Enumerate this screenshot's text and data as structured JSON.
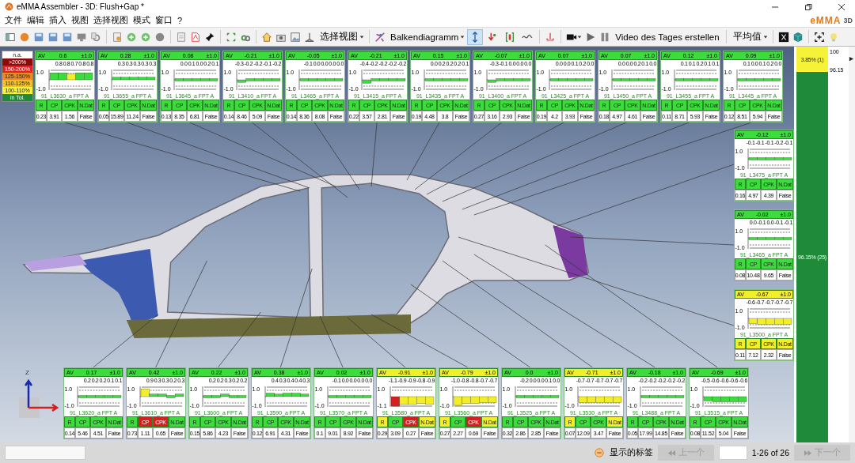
{
  "window": {
    "title": "eMMA Assembler - 3D: Flush+Gap *",
    "logo": {
      "name": "eMMA",
      "suffix": "3D"
    }
  },
  "menu": [
    "文件",
    "编辑",
    "插入",
    "视图",
    "选择视图",
    "模式",
    "窗口",
    "?"
  ],
  "toolbar": {
    "view_menu": "选择视图",
    "chart_menu": "Balkendiagramm",
    "toggles": [
      {
        "selected": true
      },
      {
        "selected": false
      },
      {
        "selected": false
      },
      {
        "selected": false
      }
    ],
    "video_button": "Video des Tages erstellen",
    "stat_menu": "平均值"
  },
  "legend": [
    {
      "label": "n.a.",
      "color": "#ffffff"
    },
    {
      "label": ">200%",
      "color": "#8c0a0a"
    },
    {
      "label": "150-200%",
      "color": "#e02424"
    },
    {
      "label": "125-150%",
      "color": "#ee8a1c"
    },
    {
      "label": "110-125%",
      "color": "#f2c02c"
    },
    {
      "label": "100-110%",
      "color": "#f4f040"
    },
    {
      "label": "in Tol.",
      "color": "#1f8a3a"
    }
  ],
  "gizmo": {
    "z_label": "Z"
  },
  "top_cards": [
    {
      "color": "#3bdc3b",
      "av_label": "AV",
      "av": "0.6",
      "tol": "±1.0",
      "points": [
        {
          "value": "0.8",
          "color": "#3bdc3b"
        },
        {
          "value": "0.8",
          "color": "#3bdc3b"
        },
        {
          "value": "0.7",
          "color": "#f2ee2a"
        },
        {
          "value": "0.8",
          "color": "#3bdc3b"
        },
        {
          "value": "0.8",
          "color": "#3bdc3b"
        }
      ],
      "scale": [
        "1.0",
        "-1.0"
      ],
      "name": "91_L3630_a FPT A",
      "stats": [
        {
          "label": "R",
          "value": "0.23",
          "color": "#3bdc3b"
        },
        {
          "label": "CP",
          "value": "3.91",
          "color": "#3bdc3b"
        },
        {
          "label": "CPK",
          "value": "1.56",
          "color": "#3bdc3b"
        },
        {
          "label": "N.Dat",
          "value": "False",
          "color": "#3bdc3b"
        }
      ]
    },
    {
      "color": "#3bdc3b",
      "av_label": "AV",
      "av": "0.28",
      "tol": "±1.0",
      "points": [
        {
          "value": "0.3",
          "color": "#3bdc3b"
        },
        {
          "value": "0.3",
          "color": "#3bdc3b"
        },
        {
          "value": "0.3",
          "color": "#3bdc3b"
        },
        {
          "value": "0.3",
          "color": "#3bdc3b"
        },
        {
          "value": "0.3",
          "color": "#3bdc3b"
        }
      ],
      "scale": [
        "1.0",
        "-1.0"
      ],
      "name": "91_L3655_a FPT A",
      "stats": [
        {
          "label": "R",
          "value": "0.05",
          "color": "#3bdc3b"
        },
        {
          "label": "CP",
          "value": "15.89",
          "color": "#3bdc3b"
        },
        {
          "label": "CPK",
          "value": "11.24",
          "color": "#3bdc3b"
        },
        {
          "label": "N.Dat",
          "value": "False",
          "color": "#3bdc3b"
        }
      ]
    },
    {
      "color": "#3bdc3b",
      "av_label": "AV",
      "av": "0.08",
      "tol": "±1.0",
      "points": [
        {
          "value": "0.0",
          "color": "#3bdc3b"
        },
        {
          "value": "0.1",
          "color": "#3bdc3b"
        },
        {
          "value": "0.0",
          "color": "#3bdc3b"
        },
        {
          "value": "0.2",
          "color": "#3bdc3b"
        },
        {
          "value": "0.1",
          "color": "#3bdc3b"
        }
      ],
      "scale": [
        "1.0",
        "-1.0"
      ],
      "name": "91_L3645_a FPT A",
      "stats": [
        {
          "label": "R",
          "value": "0.13",
          "color": "#3bdc3b"
        },
        {
          "label": "CP",
          "value": "8.35",
          "color": "#3bdc3b"
        },
        {
          "label": "CPK",
          "value": "6.81",
          "color": "#3bdc3b"
        },
        {
          "label": "N.Dat",
          "value": "False",
          "color": "#3bdc3b"
        }
      ]
    },
    {
      "color": "#3bdc3b",
      "av_label": "AV",
      "av": "-0.21",
      "tol": "±1.0",
      "points": [
        {
          "value": "-0.3",
          "color": "#3bdc3b"
        },
        {
          "value": "-0.2",
          "color": "#3bdc3b"
        },
        {
          "value": "-0.2",
          "color": "#3bdc3b"
        },
        {
          "value": "-0.1",
          "color": "#3bdc3b"
        },
        {
          "value": "-0.2",
          "color": "#3bdc3b"
        }
      ],
      "scale": [
        "1.0",
        "-1.0"
      ],
      "name": "91_L3410_a FPT A",
      "stats": [
        {
          "label": "R",
          "value": "0.14",
          "color": "#3bdc3b"
        },
        {
          "label": "CP",
          "value": "8.46",
          "color": "#3bdc3b"
        },
        {
          "label": "CPK",
          "value": "5.09",
          "color": "#3bdc3b"
        },
        {
          "label": "N.Dat",
          "value": "False",
          "color": "#3bdc3b"
        }
      ]
    },
    {
      "color": "#3bdc3b",
      "av_label": "AV",
      "av": "-0.05",
      "tol": "±1.0",
      "points": [
        {
          "value": "-0.1",
          "color": "#3bdc3b"
        },
        {
          "value": "0.0",
          "color": "#3bdc3b"
        },
        {
          "value": "0.0",
          "color": "#3bdc3b"
        },
        {
          "value": "0.0",
          "color": "#3bdc3b"
        },
        {
          "value": "0.0",
          "color": "#3bdc3b"
        }
      ],
      "scale": [
        "1.0",
        "-1.0"
      ],
      "name": "91_L3465_a FPT A",
      "stats": [
        {
          "label": "R",
          "value": "0.14",
          "color": "#3bdc3b"
        },
        {
          "label": "CP",
          "value": "8.36",
          "color": "#3bdc3b"
        },
        {
          "label": "CPK",
          "value": "8.08",
          "color": "#3bdc3b"
        },
        {
          "label": "N.Dat",
          "value": "False",
          "color": "#3bdc3b"
        }
      ]
    },
    {
      "color": "#3bdc3b",
      "av_label": "AV",
      "av": "-0.21",
      "tol": "±1.0",
      "points": [
        {
          "value": "-0.4",
          "color": "#3bdc3b"
        },
        {
          "value": "-0.2",
          "color": "#3bdc3b"
        },
        {
          "value": "-0.2",
          "color": "#3bdc3b"
        },
        {
          "value": "-0.2",
          "color": "#3bdc3b"
        },
        {
          "value": "-0.2",
          "color": "#3bdc3b"
        }
      ],
      "scale": [
        "1.0",
        "-1.0"
      ],
      "name": "91_L3415_a FPT A",
      "stats": [
        {
          "label": "R",
          "value": "0.22",
          "color": "#3bdc3b"
        },
        {
          "label": "CP",
          "value": "3.57",
          "color": "#3bdc3b"
        },
        {
          "label": "CPK",
          "value": "2.81",
          "color": "#3bdc3b"
        },
        {
          "label": "N.Dat",
          "value": "False",
          "color": "#3bdc3b"
        }
      ]
    },
    {
      "color": "#3bdc3b",
      "av_label": "AV",
      "av": "0.15",
      "tol": "±1.0",
      "points": [
        {
          "value": "0.0",
          "color": "#3bdc3b"
        },
        {
          "value": "0.2",
          "color": "#3bdc3b"
        },
        {
          "value": "0.2",
          "color": "#3bdc3b"
        },
        {
          "value": "0.2",
          "color": "#3bdc3b"
        },
        {
          "value": "0.1",
          "color": "#3bdc3b"
        }
      ],
      "scale": [
        "1.0",
        "-1.0"
      ],
      "name": "91_L3435_a FPT A",
      "stats": [
        {
          "label": "R",
          "value": "0.19",
          "color": "#3bdc3b"
        },
        {
          "label": "CP",
          "value": "4.48",
          "color": "#3bdc3b"
        },
        {
          "label": "CPK",
          "value": "3.8",
          "color": "#3bdc3b"
        },
        {
          "label": "N.Dat",
          "value": "False",
          "color": "#3bdc3b"
        }
      ]
    },
    {
      "color": "#3bdc3b",
      "av_label": "AV",
      "av": "-0.07",
      "tol": "±1.0",
      "points": [
        {
          "value": "-0.3",
          "color": "#3bdc3b"
        },
        {
          "value": "-0.1",
          "color": "#3bdc3b"
        },
        {
          "value": "0.0",
          "color": "#3bdc3b"
        },
        {
          "value": "0.0",
          "color": "#3bdc3b"
        },
        {
          "value": "0.0",
          "color": "#3bdc3b"
        }
      ],
      "scale": [
        "1.0",
        "-1.0"
      ],
      "name": "91_L3400_a FPT A",
      "stats": [
        {
          "label": "R",
          "value": "0.27",
          "color": "#3bdc3b"
        },
        {
          "label": "CP",
          "value": "3.16",
          "color": "#3bdc3b"
        },
        {
          "label": "CPK",
          "value": "2.93",
          "color": "#3bdc3b"
        },
        {
          "label": "N.Dat",
          "value": "False",
          "color": "#3bdc3b"
        }
      ]
    },
    {
      "color": "#3bdc3b",
      "av_label": "AV",
      "av": "0.07",
      "tol": "±1.0",
      "points": [
        {
          "value": "0.0",
          "color": "#3bdc3b"
        },
        {
          "value": "0.0",
          "color": "#3bdc3b"
        },
        {
          "value": "0.1",
          "color": "#3bdc3b"
        },
        {
          "value": "0.2",
          "color": "#3bdc3b"
        },
        {
          "value": "0.0",
          "color": "#3bdc3b"
        }
      ],
      "scale": [
        "1.0",
        "-1.0"
      ],
      "name": "91_L3425_a FPT A",
      "stats": [
        {
          "label": "R",
          "value": "0.19",
          "color": "#3bdc3b"
        },
        {
          "label": "CP",
          "value": "4.2",
          "color": "#3bdc3b"
        },
        {
          "label": "CPK",
          "value": "3.93",
          "color": "#3bdc3b"
        },
        {
          "label": "N.Dat",
          "value": "False",
          "color": "#3bdc3b"
        }
      ]
    },
    {
      "color": "#3bdc3b",
      "av_label": "AV",
      "av": "0.07",
      "tol": "±1.0",
      "points": [
        {
          "value": "0.0",
          "color": "#3bdc3b"
        },
        {
          "value": "0.0",
          "color": "#3bdc3b"
        },
        {
          "value": "0.2",
          "color": "#3bdc3b"
        },
        {
          "value": "0.1",
          "color": "#3bdc3b"
        },
        {
          "value": "0.0",
          "color": "#3bdc3b"
        }
      ],
      "scale": [
        "1.0",
        "-1.0"
      ],
      "name": "91_L3450_a FPT A",
      "stats": [
        {
          "label": "R",
          "value": "0.18",
          "color": "#3bdc3b"
        },
        {
          "label": "CP",
          "value": "4.97",
          "color": "#3bdc3b"
        },
        {
          "label": "CPK",
          "value": "4.61",
          "color": "#3bdc3b"
        },
        {
          "label": "N.Dat",
          "value": "False",
          "color": "#3bdc3b"
        }
      ]
    },
    {
      "color": "#3bdc3b",
      "av_label": "AV",
      "av": "0.12",
      "tol": "±1.0",
      "points": [
        {
          "value": "0.1",
          "color": "#3bdc3b"
        },
        {
          "value": "0.1",
          "color": "#3bdc3b"
        },
        {
          "value": "0.2",
          "color": "#3bdc3b"
        },
        {
          "value": "0.1",
          "color": "#3bdc3b"
        },
        {
          "value": "0.1",
          "color": "#3bdc3b"
        }
      ],
      "scale": [
        "1.0",
        "-1.0"
      ],
      "name": "91_L3455_a FPT A",
      "stats": [
        {
          "label": "R",
          "value": "0.11",
          "color": "#3bdc3b"
        },
        {
          "label": "CP",
          "value": "8.71",
          "color": "#3bdc3b"
        },
        {
          "label": "CPK",
          "value": "5.93",
          "color": "#3bdc3b"
        },
        {
          "label": "N.Dat",
          "value": "False",
          "color": "#3bdc3b"
        }
      ]
    },
    {
      "color": "#3bdc3b",
      "av_label": "AV",
      "av": "0.09",
      "tol": "±1.0",
      "points": [
        {
          "value": "0.1",
          "color": "#3bdc3b"
        },
        {
          "value": "0.0",
          "color": "#3bdc3b"
        },
        {
          "value": "0.1",
          "color": "#3bdc3b"
        },
        {
          "value": "0.2",
          "color": "#3bdc3b"
        },
        {
          "value": "0.0",
          "color": "#3bdc3b"
        }
      ],
      "scale": [
        "1.0",
        "-1.0"
      ],
      "name": "91_L3445_a FPT A",
      "stats": [
        {
          "label": "R",
          "value": "0.12",
          "color": "#3bdc3b"
        },
        {
          "label": "CP",
          "value": "8.51",
          "color": "#3bdc3b"
        },
        {
          "label": "CPK",
          "value": "5.94",
          "color": "#3bdc3b"
        },
        {
          "label": "N.Dat",
          "value": "False",
          "color": "#3bdc3b"
        }
      ]
    }
  ],
  "side_cards": [
    {
      "color": "#3bdc3b",
      "av_label": "AV",
      "av": "-0.12",
      "tol": "±1.0",
      "points": [
        {
          "value": "-0.1",
          "color": "#3bdc3b"
        },
        {
          "value": "-0.1",
          "color": "#3bdc3b"
        },
        {
          "value": "-0.1",
          "color": "#3bdc3b"
        },
        {
          "value": "-0.2",
          "color": "#3bdc3b"
        },
        {
          "value": "-0.1",
          "color": "#3bdc3b"
        }
      ],
      "scale": [
        "1.0",
        "-1.0"
      ],
      "name": "91_L3475_a FPT A",
      "stats": [
        {
          "label": "R",
          "value": "0.16",
          "color": "#3bdc3b"
        },
        {
          "label": "CP",
          "value": "4.97",
          "color": "#3bdc3b"
        },
        {
          "label": "CPK",
          "value": "4.39",
          "color": "#3bdc3b"
        },
        {
          "label": "N.Dat",
          "value": "False",
          "color": "#3bdc3b"
        }
      ]
    },
    {
      "color": "#3bdc3b",
      "av_label": "AV",
      "av": "-0.02",
      "tol": "±1.0",
      "points": [
        {
          "value": "0.0",
          "color": "#3bdc3b"
        },
        {
          "value": "-0.1",
          "color": "#3bdc3b"
        },
        {
          "value": "0.0",
          "color": "#3bdc3b"
        },
        {
          "value": "-0.1",
          "color": "#3bdc3b"
        },
        {
          "value": "-0.1",
          "color": "#3bdc3b"
        }
      ],
      "scale": [
        "1.0",
        "-1.0"
      ],
      "name": "91_L3465_a FPT A",
      "stats": [
        {
          "label": "R",
          "value": "0.08",
          "color": "#3bdc3b"
        },
        {
          "label": "CP",
          "value": "10.48",
          "color": "#3bdc3b"
        },
        {
          "label": "CPK",
          "value": "9.65",
          "color": "#3bdc3b"
        },
        {
          "label": "N.Dat",
          "value": "False",
          "color": "#3bdc3b"
        }
      ]
    },
    {
      "color": "#f2ee2a",
      "av_label": "AV",
      "av": "-0.67",
      "tol": "±1.0",
      "points": [
        {
          "value": "-0.6",
          "color": "#f2ee2a"
        },
        {
          "value": "-0.7",
          "color": "#f2ee2a"
        },
        {
          "value": "-0.7",
          "color": "#f2ee2a"
        },
        {
          "value": "-0.7",
          "color": "#f2ee2a"
        },
        {
          "value": "-0.7",
          "color": "#f2ee2a"
        }
      ],
      "scale": [
        "1.0",
        "-1.0"
      ],
      "name": "91_L3500_a FPT A",
      "stats": [
        {
          "label": "R",
          "value": "0.11",
          "color": "#f2ee2a"
        },
        {
          "label": "CP",
          "value": "7.12",
          "color": "#f2ee2a"
        },
        {
          "label": "CPK",
          "value": "2.32",
          "color": "#f2ee2a"
        },
        {
          "label": "N.Dat",
          "value": "False",
          "color": "#f2ee2a"
        }
      ]
    }
  ],
  "bottom_cards": [
    {
      "color": "#3bdc3b",
      "av_label": "AV",
      "av": "0.17",
      "tol": "±1.0",
      "points": [
        {
          "value": "0.2",
          "color": "#3bdc3b"
        },
        {
          "value": "0.2",
          "color": "#3bdc3b"
        },
        {
          "value": "0.2",
          "color": "#3bdc3b"
        },
        {
          "value": "0.1",
          "color": "#3bdc3b"
        },
        {
          "value": "0.1",
          "color": "#3bdc3b"
        }
      ],
      "scale": [
        "1.0",
        "-1.0"
      ],
      "name": "91_L3620_a FPT A",
      "stats": [
        {
          "label": "R",
          "value": "0.14",
          "color": "#3bdc3b"
        },
        {
          "label": "CP",
          "value": "5.46",
          "color": "#3bdc3b"
        },
        {
          "label": "CPK",
          "value": "4.51",
          "color": "#3bdc3b"
        },
        {
          "label": "N.Dat",
          "value": "False",
          "color": "#3bdc3b"
        }
      ]
    },
    {
      "color": "#3bdc3b",
      "av_label": "AV",
      "av": "0.42",
      "tol": "±1.0",
      "points": [
        {
          "value": "0.9",
          "color": "#f2ee2a"
        },
        {
          "value": "0.3",
          "color": "#3bdc3b"
        },
        {
          "value": "0.3",
          "color": "#3bdc3b"
        },
        {
          "value": "0.2",
          "color": "#3bdc3b"
        },
        {
          "value": "0.3",
          "color": "#3bdc3b"
        }
      ],
      "scale": [
        "1.0",
        "-1.0"
      ],
      "name": "91_L3610_a FPT A",
      "stats": [
        {
          "label": "R",
          "value": "0.73",
          "color": "#3bdc3b"
        },
        {
          "label": "CP",
          "value": "1.11",
          "color": "#d62020"
        },
        {
          "label": "CPK",
          "value": "0.65",
          "color": "#d62020"
        },
        {
          "label": "N.Dat",
          "value": "False",
          "color": "#3bdc3b"
        }
      ]
    },
    {
      "color": "#3bdc3b",
      "av_label": "AV",
      "av": "0.22",
      "tol": "±1.0",
      "points": [
        {
          "value": "0.2",
          "color": "#3bdc3b"
        },
        {
          "value": "0.2",
          "color": "#3bdc3b"
        },
        {
          "value": "0.3",
          "color": "#3bdc3b"
        },
        {
          "value": "0.2",
          "color": "#3bdc3b"
        },
        {
          "value": "0.2",
          "color": "#3bdc3b"
        }
      ],
      "scale": [
        "1.0",
        "-1.0"
      ],
      "name": "91_L3600_a FPT A",
      "stats": [
        {
          "label": "R",
          "value": "0.15",
          "color": "#3bdc3b"
        },
        {
          "label": "CP",
          "value": "5.86",
          "color": "#3bdc3b"
        },
        {
          "label": "CPK",
          "value": "4.23",
          "color": "#3bdc3b"
        },
        {
          "label": "N.Dat",
          "value": "False",
          "color": "#3bdc3b"
        }
      ]
    },
    {
      "color": "#3bdc3b",
      "av_label": "AV",
      "av": "0.38",
      "tol": "±1.0",
      "points": [
        {
          "value": "0.4",
          "color": "#3bdc3b"
        },
        {
          "value": "0.3",
          "color": "#3bdc3b"
        },
        {
          "value": "0.4",
          "color": "#3bdc3b"
        },
        {
          "value": "0.4",
          "color": "#3bdc3b"
        },
        {
          "value": "0.3",
          "color": "#3bdc3b"
        }
      ],
      "scale": [
        "1.0",
        "-1.0"
      ],
      "name": "91_L3590_a FPT A",
      "stats": [
        {
          "label": "R",
          "value": "0.12",
          "color": "#3bdc3b"
        },
        {
          "label": "CP",
          "value": "6.91",
          "color": "#3bdc3b"
        },
        {
          "label": "CPK",
          "value": "4.31",
          "color": "#3bdc3b"
        },
        {
          "label": "N.Dat",
          "value": "False",
          "color": "#3bdc3b"
        }
      ]
    },
    {
      "color": "#3bdc3b",
      "av_label": "AV",
      "av": "0.02",
      "tol": "±1.0",
      "points": [
        {
          "value": "-0.1",
          "color": "#3bdc3b"
        },
        {
          "value": "0.0",
          "color": "#3bdc3b"
        },
        {
          "value": "0.0",
          "color": "#3bdc3b"
        },
        {
          "value": "0.0",
          "color": "#3bdc3b"
        },
        {
          "value": "0.0",
          "color": "#3bdc3b"
        }
      ],
      "scale": [
        "1.0",
        "-1.0"
      ],
      "name": "91_L3570_a FPT A",
      "stats": [
        {
          "label": "R",
          "value": "0.1",
          "color": "#3bdc3b"
        },
        {
          "label": "CP",
          "value": "9.01",
          "color": "#3bdc3b"
        },
        {
          "label": "CPK",
          "value": "8.92",
          "color": "#3bdc3b"
        },
        {
          "label": "N.Dat",
          "value": "False",
          "color": "#3bdc3b"
        }
      ]
    },
    {
      "color": "#f2ee2a",
      "av_label": "AV",
      "av": "-0.91",
      "tol": "±1.0",
      "points": [
        {
          "value": "-1.1",
          "color": "#d62020"
        },
        {
          "value": "-0.9",
          "color": "#f2ee2a"
        },
        {
          "value": "-0.9",
          "color": "#f2ee2a"
        },
        {
          "value": "-0.8",
          "color": "#f2ee2a"
        },
        {
          "value": "-0.9",
          "color": "#f2ee2a"
        }
      ],
      "scale": [
        "1.0",
        "-1.1"
      ],
      "name": "91_L3580_a FPT A",
      "stats": [
        {
          "label": "R",
          "value": "0.29",
          "color": "#f2ee2a"
        },
        {
          "label": "CP",
          "value": "3.09",
          "color": "#3bdc3b"
        },
        {
          "label": "CPK",
          "value": "0.27",
          "color": "#d62020"
        },
        {
          "label": "N.Dat",
          "value": "False",
          "color": "#f2ee2a"
        }
      ]
    },
    {
      "color": "#f2ee2a",
      "av_label": "AV",
      "av": "-0.79",
      "tol": "±1.0",
      "points": [
        {
          "value": "-1.0",
          "color": "#f2ee2a"
        },
        {
          "value": "-0.8",
          "color": "#f2ee2a"
        },
        {
          "value": "-0.8",
          "color": "#f2ee2a"
        },
        {
          "value": "-0.7",
          "color": "#f2ee2a"
        },
        {
          "value": "-0.7",
          "color": "#f2ee2a"
        }
      ],
      "scale": [
        "1.0",
        "-1.0"
      ],
      "name": "91_L3560_a FPT A",
      "stats": [
        {
          "label": "R",
          "value": "0.27",
          "color": "#f2ee2a"
        },
        {
          "label": "CP",
          "value": "2.27",
          "color": "#3bdc3b"
        },
        {
          "label": "CPK",
          "value": "0.69",
          "color": "#d62020"
        },
        {
          "label": "N.Dat",
          "value": "False",
          "color": "#f2ee2a"
        }
      ]
    },
    {
      "color": "#3bdc3b",
      "av_label": "AV",
      "av": "0.0",
      "tol": "±1.0",
      "points": [
        {
          "value": "-0.2",
          "color": "#3bdc3b"
        },
        {
          "value": "0.0",
          "color": "#3bdc3b"
        },
        {
          "value": "0.0",
          "color": "#3bdc3b"
        },
        {
          "value": "0.1",
          "color": "#3bdc3b"
        },
        {
          "value": "0.0",
          "color": "#3bdc3b"
        }
      ],
      "scale": [
        "1.0",
        "-1.0"
      ],
      "name": "91_L3525_a FPT A",
      "stats": [
        {
          "label": "R",
          "value": "0.32",
          "color": "#3bdc3b"
        },
        {
          "label": "CP",
          "value": "2.86",
          "color": "#3bdc3b"
        },
        {
          "label": "CPK",
          "value": "2.85",
          "color": "#3bdc3b"
        },
        {
          "label": "N.Dat",
          "value": "False",
          "color": "#3bdc3b"
        }
      ]
    },
    {
      "color": "#f2ee2a",
      "av_label": "AV",
      "av": "-0.71",
      "tol": "±1.0",
      "points": [
        {
          "value": "-0.7",
          "color": "#f2ee2a"
        },
        {
          "value": "-0.7",
          "color": "#f2ee2a"
        },
        {
          "value": "-0.7",
          "color": "#f2ee2a"
        },
        {
          "value": "-0.7",
          "color": "#f2ee2a"
        },
        {
          "value": "-0.7",
          "color": "#f2ee2a"
        }
      ],
      "scale": [
        "1.0",
        "-1.0"
      ],
      "name": "91_L3530_a FPT A",
      "stats": [
        {
          "label": "R",
          "value": "0.07",
          "color": "#f2ee2a"
        },
        {
          "label": "CP",
          "value": "12.09",
          "color": "#3bdc3b"
        },
        {
          "label": "CPK",
          "value": "3.47",
          "color": "#3bdc3b"
        },
        {
          "label": "N.Dat",
          "value": "False",
          "color": "#f2ee2a"
        }
      ]
    },
    {
      "color": "#3bdc3b",
      "av_label": "AV",
      "av": "-0.18",
      "tol": "±1.0",
      "points": [
        {
          "value": "-0.2",
          "color": "#3bdc3b"
        },
        {
          "value": "-0.2",
          "color": "#3bdc3b"
        },
        {
          "value": "-0.2",
          "color": "#3bdc3b"
        },
        {
          "value": "-0.2",
          "color": "#3bdc3b"
        },
        {
          "value": "-0.2",
          "color": "#3bdc3b"
        }
      ],
      "scale": [
        "1.0",
        "-1.0"
      ],
      "name": "91_L3488_a FPT A",
      "stats": [
        {
          "label": "R",
          "value": "0.05",
          "color": "#3bdc3b"
        },
        {
          "label": "CP",
          "value": "17.99",
          "color": "#3bdc3b"
        },
        {
          "label": "CPK",
          "value": "14.85",
          "color": "#3bdc3b"
        },
        {
          "label": "N.Dat",
          "value": "False",
          "color": "#3bdc3b"
        }
      ]
    },
    {
      "color": "#3bdc3b",
      "av_label": "AV",
      "av": "-0.69",
      "tol": "±1.0",
      "points": [
        {
          "value": "-0.5",
          "color": "#3bdc3b"
        },
        {
          "value": "-0.6",
          "color": "#3bdc3b"
        },
        {
          "value": "-0.6",
          "color": "#3bdc3b"
        },
        {
          "value": "-0.6",
          "color": "#3bdc3b"
        },
        {
          "value": "-0.6",
          "color": "#3bdc3b"
        }
      ],
      "scale": [
        "1.0",
        "-1.0"
      ],
      "name": "91_L3515_a FPT A",
      "stats": [
        {
          "label": "R",
          "value": "0.08",
          "color": "#3bdc3b"
        },
        {
          "label": "CP",
          "value": "11.52",
          "color": "#3bdc3b"
        },
        {
          "label": "CPK",
          "value": "5.04",
          "color": "#3bdc3b"
        },
        {
          "label": "N.Dat",
          "value": "False",
          "color": "#3bdc3b"
        }
      ]
    }
  ],
  "summary": {
    "segments": [
      {
        "label": "3.85% (1)",
        "color": "#f6f23a"
      },
      {
        "label": "96.15% (25)",
        "color": "#1f8a3a"
      }
    ],
    "axis_labels": [
      "100",
      "96.15"
    ]
  },
  "status_bar": {
    "filter_label": "显示的标签",
    "prev": {
      "label": "上一个",
      "disabled": true
    },
    "range": "1-26 of 26",
    "next": {
      "label": "下一个",
      "disabled": true
    }
  }
}
